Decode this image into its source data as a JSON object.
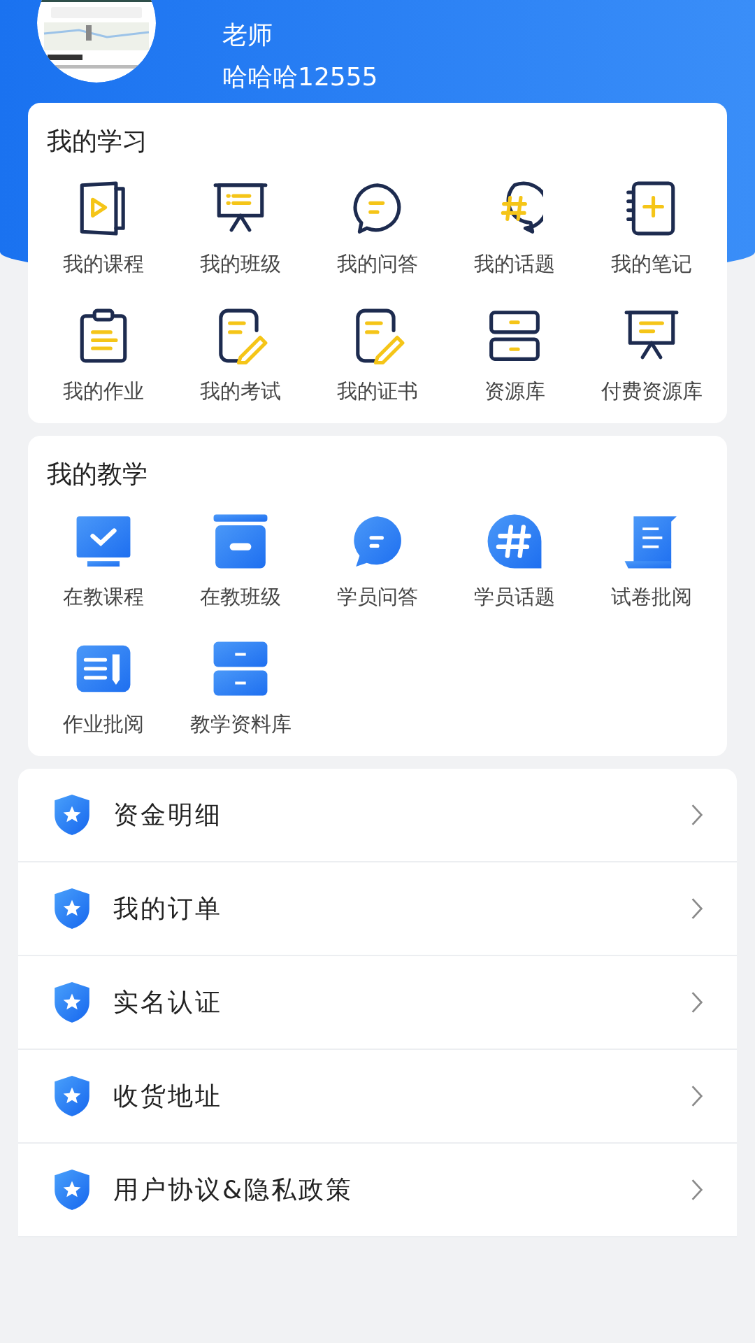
{
  "profile": {
    "role": "老师",
    "name": "哈哈哈12555"
  },
  "study": {
    "title": "我的学习",
    "items": [
      {
        "label": "我的课程"
      },
      {
        "label": "我的班级"
      },
      {
        "label": "我的问答"
      },
      {
        "label": "我的话题"
      },
      {
        "label": "我的笔记"
      },
      {
        "label": "我的作业"
      },
      {
        "label": "我的考试"
      },
      {
        "label": "我的证书"
      },
      {
        "label": "资源库"
      },
      {
        "label": "付费资源库"
      }
    ]
  },
  "teaching": {
    "title": "我的教学",
    "items": [
      {
        "label": "在教课程"
      },
      {
        "label": "在教班级"
      },
      {
        "label": "学员问答"
      },
      {
        "label": "学员话题"
      },
      {
        "label": "试卷批阅"
      },
      {
        "label": "作业批阅"
      },
      {
        "label": "教学资料库"
      }
    ]
  },
  "menu": [
    {
      "label": "资金明细"
    },
    {
      "label": "我的订单"
    },
    {
      "label": "实名认证"
    },
    {
      "label": "收货地址"
    },
    {
      "label": "用户协议&隐私政策"
    }
  ]
}
